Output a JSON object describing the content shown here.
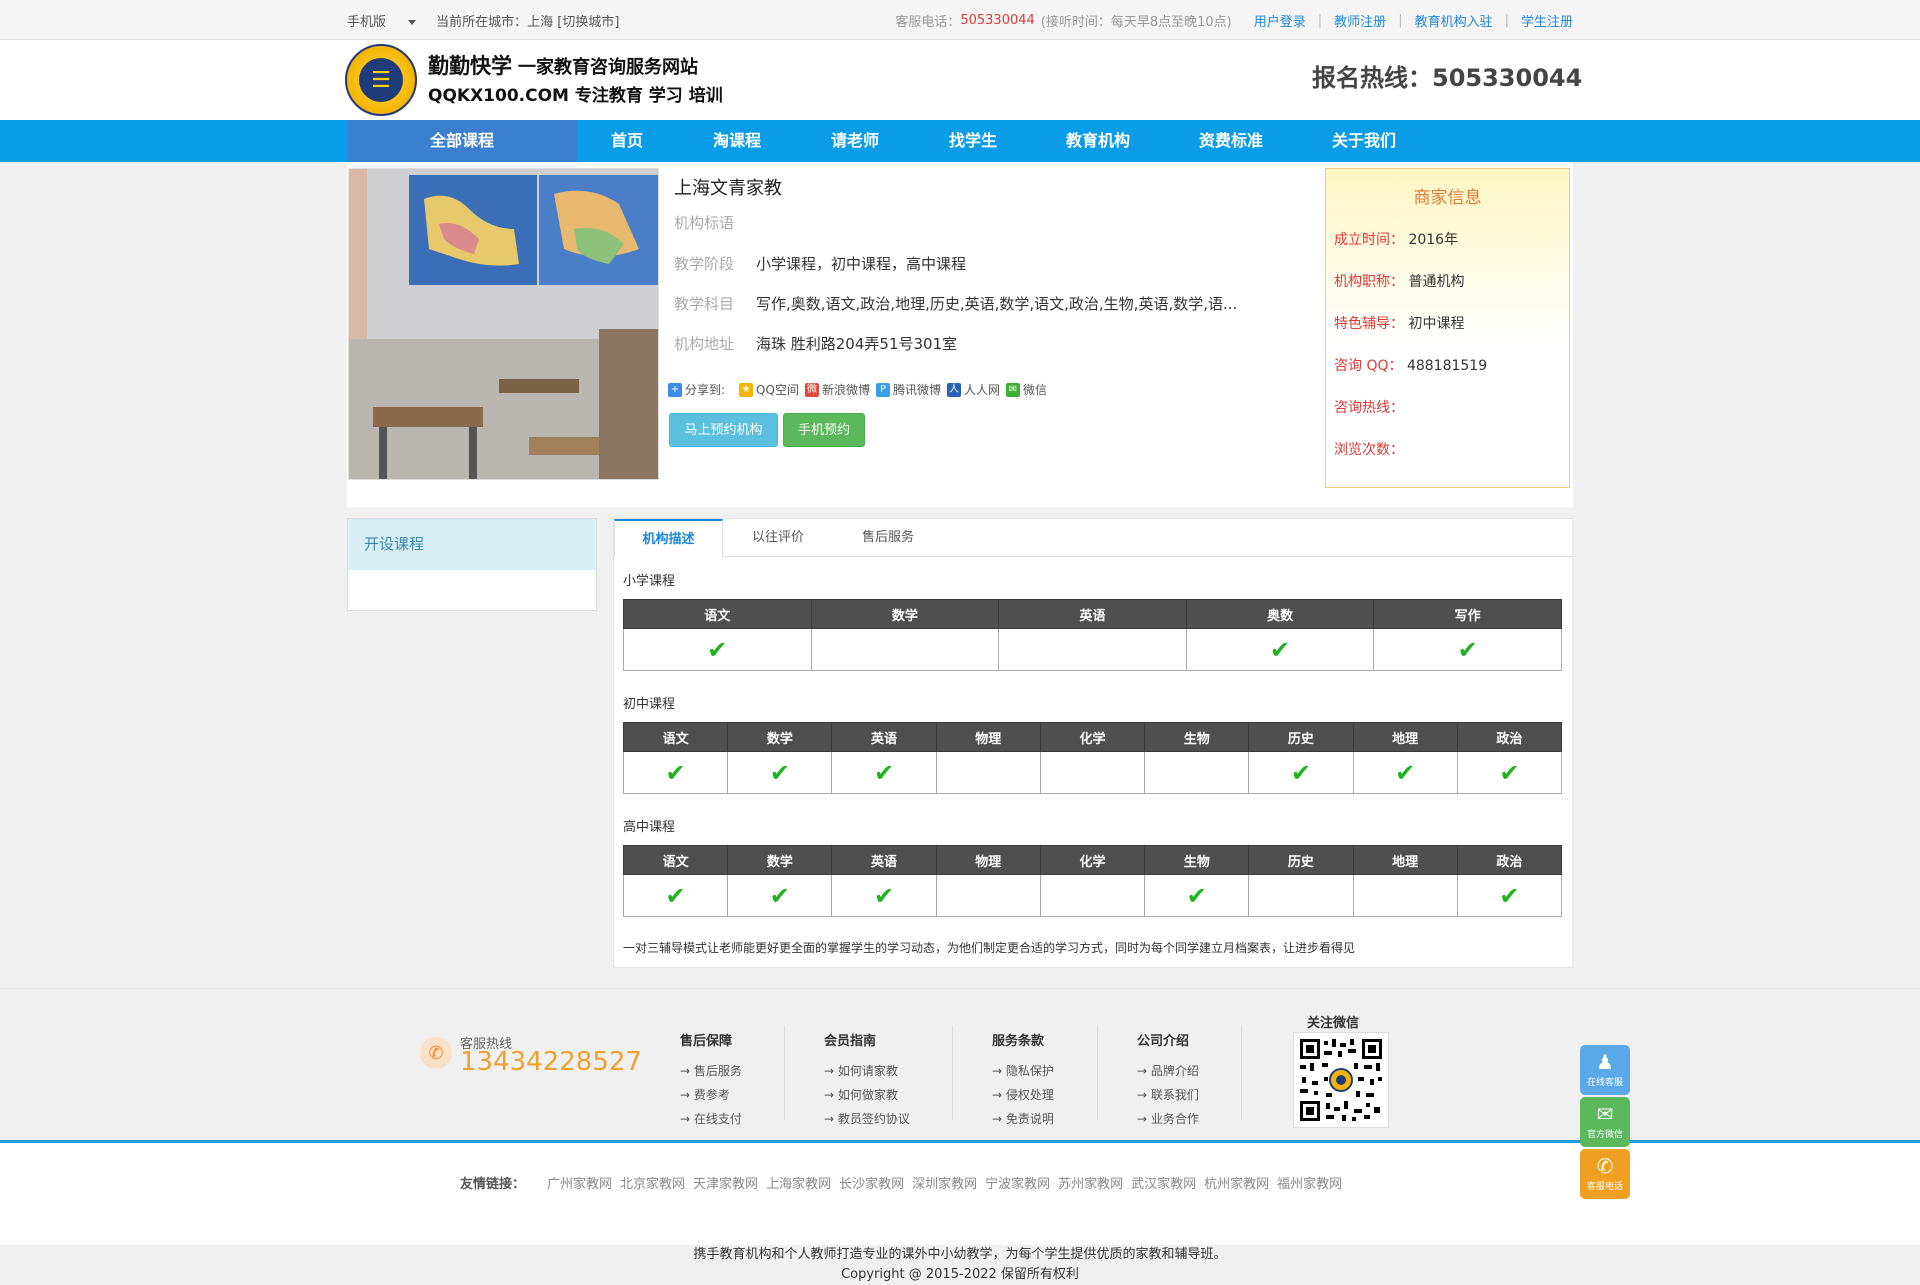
{
  "topbar": {
    "mobile": "手机版",
    "city_label": "当前所在城市：上海 [切换城市]",
    "service_label": "客服电话：",
    "service_phone": "505330044",
    "service_hours": "(接听时间：每天早8点至晚10点)",
    "links": [
      "用户登录",
      "教师注册",
      "教育机构入驻",
      "学生注册"
    ]
  },
  "header": {
    "brand_name": "勤勤快学",
    "brand_sub": "一家教育咨询服务网站",
    "brand_line2": "QQKX100.COM  专注教育 学习 培训",
    "hotline_label": "报名热线：",
    "hotline": "505330044"
  },
  "nav": {
    "items": [
      "全部课程",
      "首页",
      "淘课程",
      "请老师",
      "找学生",
      "教育机构",
      "资费标准",
      "关于我们"
    ]
  },
  "org": {
    "name": "上海文青家教",
    "slogan_label": "机构标语",
    "stage_label": "教学阶段",
    "stage": "小学课程，初中课程，高中课程",
    "subject_label": "教学科目",
    "subjects": "写作,奥数,语文,政治,地理,历史,英语,数学,语文,政治,生物,英语,数学,语...",
    "address_label": "机构地址",
    "address": "海珠 胜利路204弄51号301室",
    "share_label": "分享到:",
    "share_items": [
      "QQ空间",
      "新浪微博",
      "腾讯微博",
      "人人网",
      "微信"
    ],
    "btn_book": "马上预约机构",
    "btn_mobile": "手机预约"
  },
  "merchant": {
    "title": "商家信息",
    "rows": [
      {
        "label": "成立时间：",
        "value": "2016年"
      },
      {
        "label": "机构职称：",
        "value": "普通机构"
      },
      {
        "label": "特色辅导：",
        "value": "初中课程"
      },
      {
        "label": "咨询 QQ：",
        "value": "488181519"
      },
      {
        "label": "咨询热线：",
        "value": ""
      },
      {
        "label": "浏览次数：",
        "value": ""
      }
    ]
  },
  "side": {
    "title": "开设课程"
  },
  "tabs": [
    "机构描述",
    "以往评价",
    "售后服务"
  ],
  "courses": [
    {
      "title": "小学课程",
      "subjects": [
        "语文",
        "数学",
        "英语",
        "奥数",
        "写作"
      ],
      "checked": [
        true,
        false,
        false,
        true,
        true
      ]
    },
    {
      "title": "初中课程",
      "subjects": [
        "语文",
        "数学",
        "英语",
        "物理",
        "化学",
        "生物",
        "历史",
        "地理",
        "政治"
      ],
      "checked": [
        true,
        true,
        true,
        false,
        false,
        false,
        true,
        true,
        true
      ]
    },
    {
      "title": "高中课程",
      "subjects": [
        "语文",
        "数学",
        "英语",
        "物理",
        "化学",
        "生物",
        "历史",
        "地理",
        "政治"
      ],
      "checked": [
        true,
        true,
        true,
        false,
        false,
        true,
        false,
        false,
        true
      ]
    }
  ],
  "description": "一对三辅导模式让老师能更好更全面的掌握学生的学习动态，为他们制定更合适的学习方式，同时为每个同学建立月档案表，让进步看得见",
  "footer": {
    "svc_label": "客服热线",
    "svc_phone": "13434228527",
    "cols": [
      {
        "title": "售后保障",
        "links": [
          "→ 售后服务",
          "→ 费参考",
          "→ 在线支付"
        ]
      },
      {
        "title": "会员指南",
        "links": [
          "→ 如何请家教",
          "→ 如何做家教",
          "→ 教员签约协议"
        ]
      },
      {
        "title": "服务条款",
        "links": [
          "→ 隐私保护",
          "→ 侵权处理",
          "→ 免责说明"
        ]
      },
      {
        "title": "公司介绍",
        "links": [
          "→ 品牌介绍",
          "→ 联系我们",
          "→ 业务合作"
        ]
      }
    ],
    "qr_title": "关注微信",
    "friend_label": "友情链接：",
    "friend_links": [
      "广州家教网",
      "北京家教网",
      "天津家教网",
      "上海家教网",
      "长沙家教网",
      "深圳家教网",
      "宁波家教网",
      "苏州家教网",
      "武汉家教网",
      "杭州家教网",
      "福州家教网"
    ],
    "copy1": "携手教育机构和个人教师打造专业的课外中小幼教学，为每个学生提供优质的家教和辅导班。",
    "copy2": "Copyright @ 2015-2022 保留所有权利"
  },
  "float": [
    {
      "label": "在线客服",
      "color": "#5aa9e6",
      "icon": "qq-icon"
    },
    {
      "label": "官方微信",
      "color": "#5cb85c",
      "icon": "wechat-icon"
    },
    {
      "label": "客服电话",
      "color": "#f0a020",
      "icon": "phone-icon"
    }
  ],
  "colors": {
    "nav": "#0b9ce8",
    "nav_active": "#3a7fd0",
    "accent_red": "#e03a3a",
    "check": "#1fb31f"
  }
}
